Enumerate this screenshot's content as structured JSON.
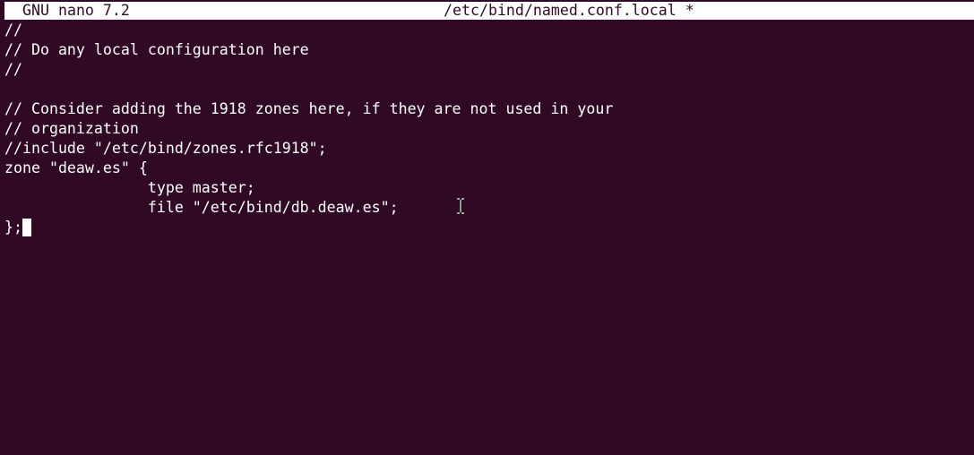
{
  "title_bar": {
    "app_name": "GNU nano 7.2",
    "file_name": "/etc/bind/named.conf.local *"
  },
  "editor": {
    "lines": [
      "//",
      "// Do any local configuration here",
      "//",
      "",
      "// Consider adding the 1918 zones here, if they are not used in your",
      "// organization",
      "//include \"/etc/bind/zones.rfc1918\";",
      "zone \"deaw.es\" {",
      "                type master;",
      "                file \"/etc/bind/db.deaw.es\";",
      "};"
    ]
  },
  "colors": {
    "background": "#300a24",
    "foreground": "#ffffff",
    "title_bar_background": "#ffffff"
  },
  "icons": {
    "mouse_pointer": "text-ibeam-icon"
  }
}
